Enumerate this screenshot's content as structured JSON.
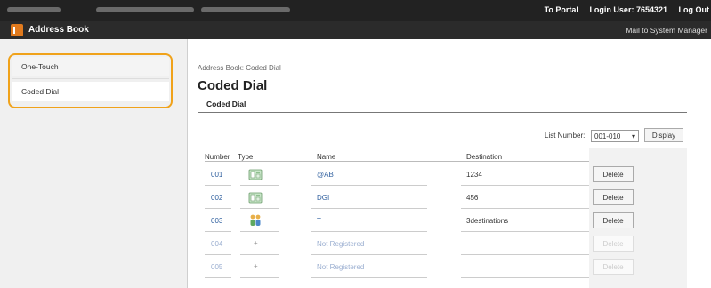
{
  "topbar": {
    "portal_link": "To Portal",
    "login_user": "Login User: 7654321",
    "logout_link": "Log Out"
  },
  "titlebar": {
    "title": "Address Book",
    "mail_link": "Mail to System Manager"
  },
  "sidebar": {
    "items": [
      {
        "label": "One-Touch"
      },
      {
        "label": "Coded Dial"
      }
    ]
  },
  "breadcrumb": "Address Book: Coded Dial",
  "page_title": "Coded Dial",
  "section_title": "Coded Dial",
  "list_number": {
    "label": "List Number:",
    "selected": "001-010",
    "display_button": "Display"
  },
  "table": {
    "headers": {
      "number": "Number",
      "type": "Type",
      "name": "Name",
      "destination": "Destination"
    },
    "rows": [
      {
        "number": "001",
        "type": "fax-icon",
        "name": "@AB",
        "destination": "1234",
        "action": "Delete"
      },
      {
        "number": "002",
        "type": "fax-icon",
        "name": "DGI",
        "destination": "456",
        "action": "Delete"
      },
      {
        "number": "003",
        "type": "group-icon",
        "name": "T",
        "destination": "3destinations",
        "action": "Delete"
      },
      {
        "number": "004",
        "type": "+",
        "name": "Not Registered",
        "destination": "",
        "action": "Delete"
      },
      {
        "number": "005",
        "type": "+",
        "name": "Not Registered",
        "destination": "",
        "action": "Delete"
      }
    ]
  },
  "colors": {
    "accent": "#f0a21a",
    "header": "#222222",
    "link": "#2f5f9e"
  }
}
